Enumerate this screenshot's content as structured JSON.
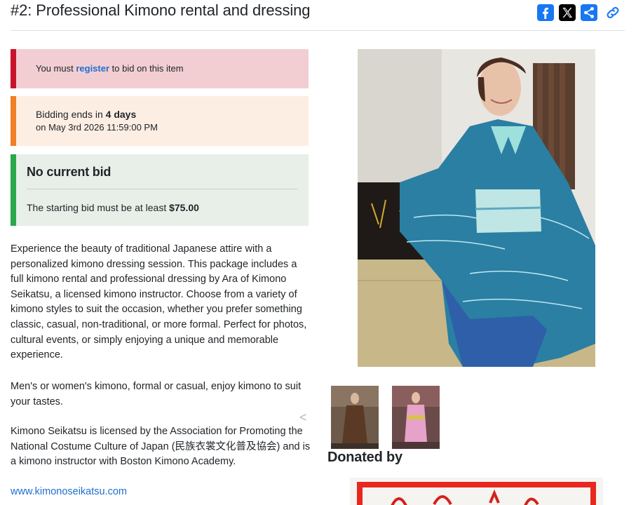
{
  "header": {
    "title": "#2: Professional Kimono rental and dressing"
  },
  "share": {
    "icons": [
      "facebook-icon",
      "x-icon",
      "share-icon",
      "link-icon"
    ],
    "facebook_color": "#1877f2",
    "x_color": "#000000"
  },
  "register_alert": {
    "prefix": "You must ",
    "link": "register",
    "suffix": " to bid on this item",
    "border_color": "#c8142b"
  },
  "bidding_alert": {
    "prefix": "Bidding ends in ",
    "duration": "4 days",
    "date": "on May 3rd 2026 11:59:00 PM",
    "border_color": "#f07f26"
  },
  "bid_status": {
    "heading": "No current bid",
    "min_prefix": "The starting bid must be at least ",
    "min_amount": "$75.00",
    "border_color": "#2aa84a"
  },
  "description": {
    "p1": "Experience the beauty of traditional Japanese attire with a personalized kimono dressing session. This package includes a full kimono rental and professional dressing by Ara of Kimono Seikatsu, a licensed kimono instructor. Choose from a variety of kimono styles to suit the occasion, whether you prefer something classic, casual, non-traditional, or more formal. Perfect for photos, cultural events, or simply enjoying a unique and memorable experience.",
    "p2": "Men's or women's kimono, formal or casual, enjoy kimono to suit your tastes.",
    "p3": "Kimono Seikatsu is licensed by the Association for Promoting the National Costume Culture of Japan (民族衣裳文化普及協会) and is a kimono instructor with Boston Kimono Academy.",
    "website": "www.kimonoseikatsu.com"
  },
  "gallery": {
    "prev_glyph": "<"
  },
  "donated_heading": "Donated by"
}
